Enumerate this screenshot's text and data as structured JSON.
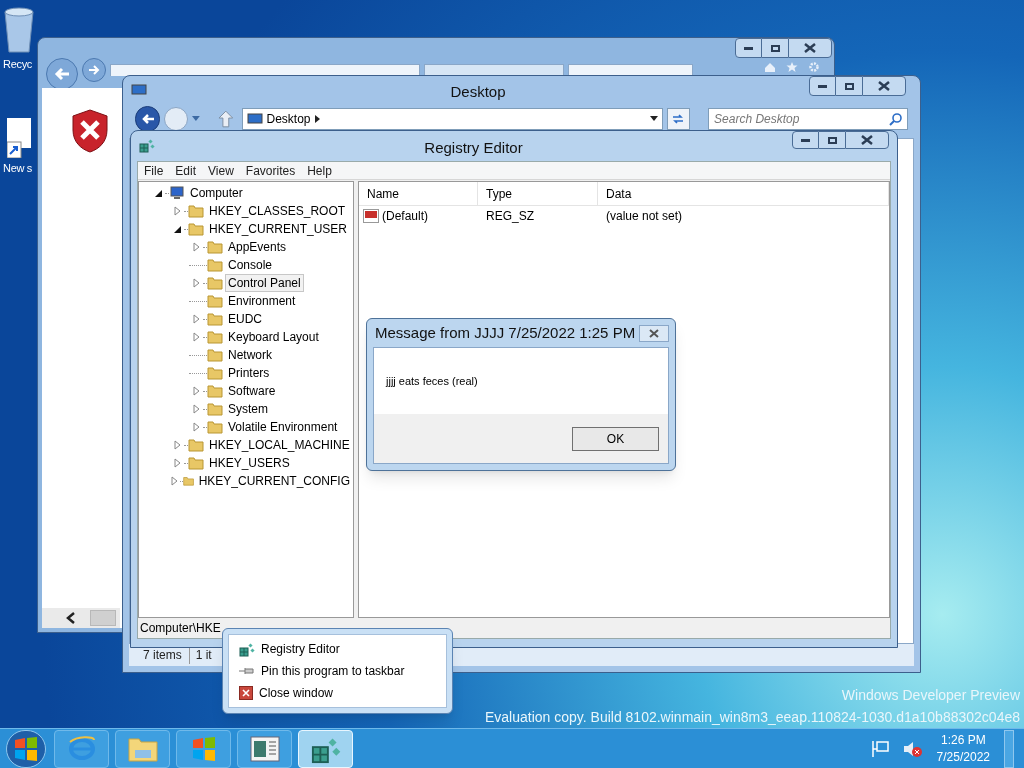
{
  "desktop_icons": [
    {
      "label": "Recyc",
      "kind": "bin"
    },
    {
      "label": "New s",
      "kind": "shortcut"
    }
  ],
  "explorer": {
    "title": "Desktop",
    "address": "Desktop",
    "search": {
      "placeholder": "Search Desktop"
    },
    "status": [
      "7 items",
      "1 it"
    ]
  },
  "registry_editor": {
    "title": "Registry Editor",
    "menu": [
      "File",
      "Edit",
      "View",
      "Favorites",
      "Help"
    ],
    "tree": [
      {
        "label": "Computer",
        "kind": "computer",
        "expandable": true,
        "expanded": true,
        "selected": false,
        "children": [
          {
            "label": "HKEY_CLASSES_ROOT",
            "kind": "folder",
            "expandable": true,
            "expanded": false,
            "selected": false
          },
          {
            "label": "HKEY_CURRENT_USER",
            "kind": "folder",
            "expandable": true,
            "expanded": true,
            "selected": false,
            "children": [
              {
                "label": "AppEvents",
                "kind": "folder",
                "expandable": true,
                "expanded": false,
                "selected": false
              },
              {
                "label": "Console",
                "kind": "folder",
                "expandable": false,
                "selected": false
              },
              {
                "label": "Control Panel",
                "kind": "folder",
                "expandable": true,
                "expanded": false,
                "selected": true
              },
              {
                "label": "Environment",
                "kind": "folder",
                "expandable": false,
                "selected": false
              },
              {
                "label": "EUDC",
                "kind": "folder",
                "expandable": true,
                "expanded": false,
                "selected": false
              },
              {
                "label": "Keyboard Layout",
                "kind": "folder",
                "expandable": true,
                "expanded": false,
                "selected": false
              },
              {
                "label": "Network",
                "kind": "folder",
                "expandable": false,
                "selected": false
              },
              {
                "label": "Printers",
                "kind": "folder",
                "expandable": false,
                "selected": false
              },
              {
                "label": "Software",
                "kind": "folder",
                "expandable": true,
                "expanded": false,
                "selected": false
              },
              {
                "label": "System",
                "kind": "folder",
                "expandable": true,
                "expanded": false,
                "selected": false
              },
              {
                "label": "Volatile Environment",
                "kind": "folder",
                "expandable": true,
                "expanded": false,
                "selected": false
              }
            ]
          },
          {
            "label": "HKEY_LOCAL_MACHINE",
            "kind": "folder",
            "expandable": true,
            "expanded": false,
            "selected": false
          },
          {
            "label": "HKEY_USERS",
            "kind": "folder",
            "expandable": true,
            "expanded": false,
            "selected": false
          },
          {
            "label": "HKEY_CURRENT_CONFIG",
            "kind": "folder",
            "expandable": true,
            "expanded": false,
            "selected": false
          }
        ]
      }
    ],
    "columns": [
      "Name",
      "Type",
      "Data"
    ],
    "values": [
      {
        "name": "(Default)",
        "type": "REG_SZ",
        "data": "(value not set)"
      }
    ],
    "status": "Computer\\HKE"
  },
  "message_dialog": {
    "title": "Message from JJJJ  7/25/2022 1:25 PM",
    "message": "jjjj eats feces (real)",
    "button": "OK"
  },
  "jump_list": [
    {
      "label": "Registry Editor",
      "kind": "app"
    },
    {
      "label": "Pin this program to taskbar",
      "kind": "pin"
    },
    {
      "label": "Close window",
      "kind": "close"
    }
  ],
  "watermark": [
    "Windows Developer Preview",
    "Evaluation copy. Build 8102.winmain_win8m3_eeap.110824-1030.d1a10b88302c04e8"
  ],
  "taskbar": {
    "items": [
      {
        "kind": "ie",
        "selected": false
      },
      {
        "kind": "explorer",
        "selected": false
      },
      {
        "kind": "flag",
        "selected": false
      },
      {
        "kind": "window",
        "selected": false
      },
      {
        "kind": "regedit",
        "selected": true
      }
    ],
    "clock": {
      "time": "1:26 PM",
      "date": "7/25/2022"
    }
  }
}
